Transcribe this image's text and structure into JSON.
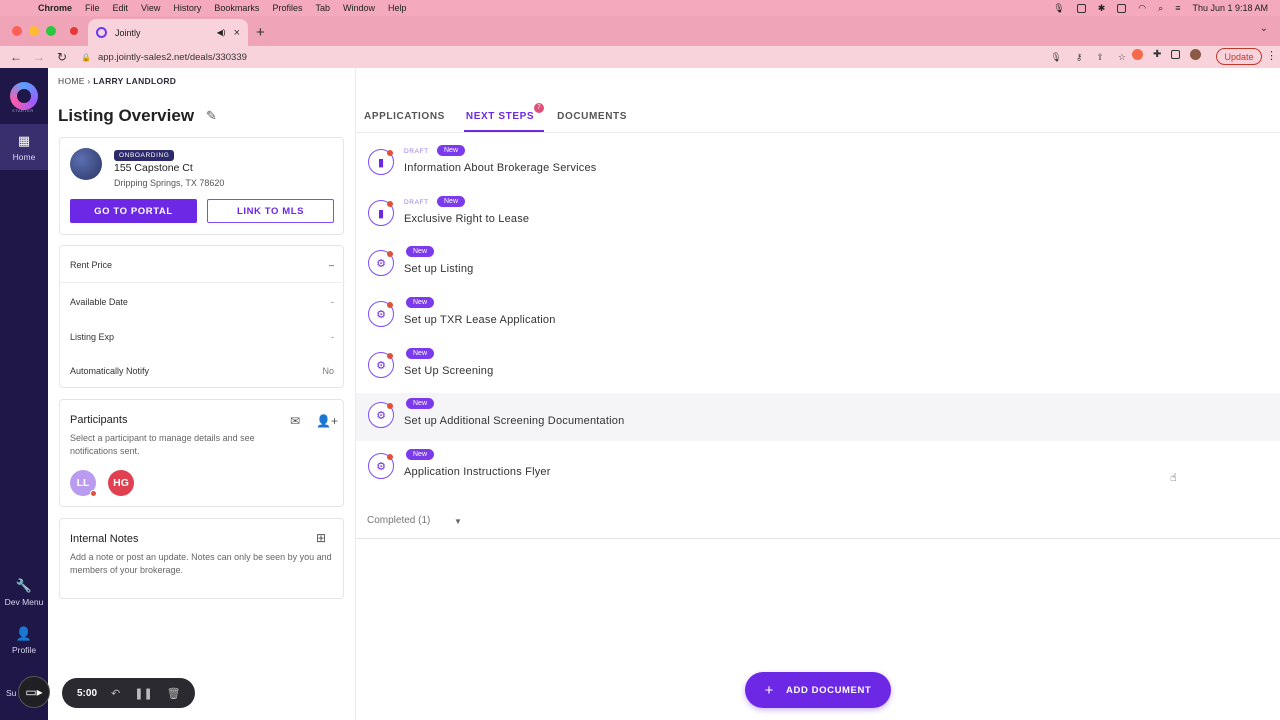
{
  "macos": {
    "menu": [
      "Chrome",
      "File",
      "Edit",
      "View",
      "History",
      "Bookmarks",
      "Profiles",
      "Tab",
      "Window",
      "Help"
    ],
    "clock": "Thu Jun 1  9:18 AM"
  },
  "browser": {
    "tab_title": "Jointly",
    "url": "app.jointly-sales2.net/deals/330339",
    "update_label": "Update"
  },
  "rail": {
    "logo_sub": "STARTER",
    "home": "Home",
    "dev_menu": "Dev Menu",
    "profile": "Profile",
    "support": "Su"
  },
  "breadcrumb": {
    "home": "HOME",
    "sep": "›",
    "current": "LARRY LANDLORD"
  },
  "listing": {
    "title": "Listing Overview",
    "status": "ONBOARDING",
    "street": "155 Capstone Ct",
    "city": "Dripping Springs, TX 78620",
    "portal_button": "GO TO PORTAL",
    "mls_button": "LINK TO MLS"
  },
  "details": [
    {
      "label": "Rent Price",
      "value": "–"
    },
    {
      "label": "Available Date",
      "value": "-"
    },
    {
      "label": "Listing Exp",
      "value": "-"
    },
    {
      "label": "Automatically Notify",
      "value": "No"
    }
  ],
  "participants": {
    "title": "Participants",
    "description": "Select a participant to manage details and see notifications sent.",
    "avatars": [
      {
        "initials": "LL",
        "color": "#b99cf0"
      },
      {
        "initials": "HG",
        "color": "#e04050"
      }
    ]
  },
  "notes": {
    "title": "Internal Notes",
    "description": "Add a note or post an update. Notes can only be seen by you and members of your brokerage."
  },
  "main": {
    "tabs": [
      "APPLICATIONS",
      "NEXT STEPS",
      "DOCUMENTS"
    ],
    "next_steps_count": "7",
    "steps": [
      {
        "draft": "DRAFT",
        "badge": "New",
        "name": "Information About Brokerage Services",
        "icon": "document-icon"
      },
      {
        "draft": "DRAFT",
        "badge": "New",
        "name": "Exclusive Right to Lease",
        "icon": "document-icon"
      },
      {
        "draft": "",
        "badge": "New",
        "name": "Set up Listing",
        "icon": "gear-icon"
      },
      {
        "draft": "",
        "badge": "New",
        "name": "Set up TXR Lease Application",
        "icon": "gear-icon"
      },
      {
        "draft": "",
        "badge": "New",
        "name": "Set Up Screening",
        "icon": "gear-icon"
      },
      {
        "draft": "",
        "badge": "New",
        "name": "Set up Additional Screening Documentation",
        "icon": "gear-icon"
      },
      {
        "draft": "",
        "badge": "New",
        "name": "Application Instructions Flyer",
        "icon": "gear-icon"
      }
    ],
    "completed_label": "Completed (1)",
    "add_document": "ADD DOCUMENT"
  },
  "recorder": {
    "time": "5:00"
  },
  "colors": {
    "accent": "#6d28e6",
    "rail": "#1f1747",
    "chrome": "#f4a9bd",
    "alert": "#e0503a"
  }
}
